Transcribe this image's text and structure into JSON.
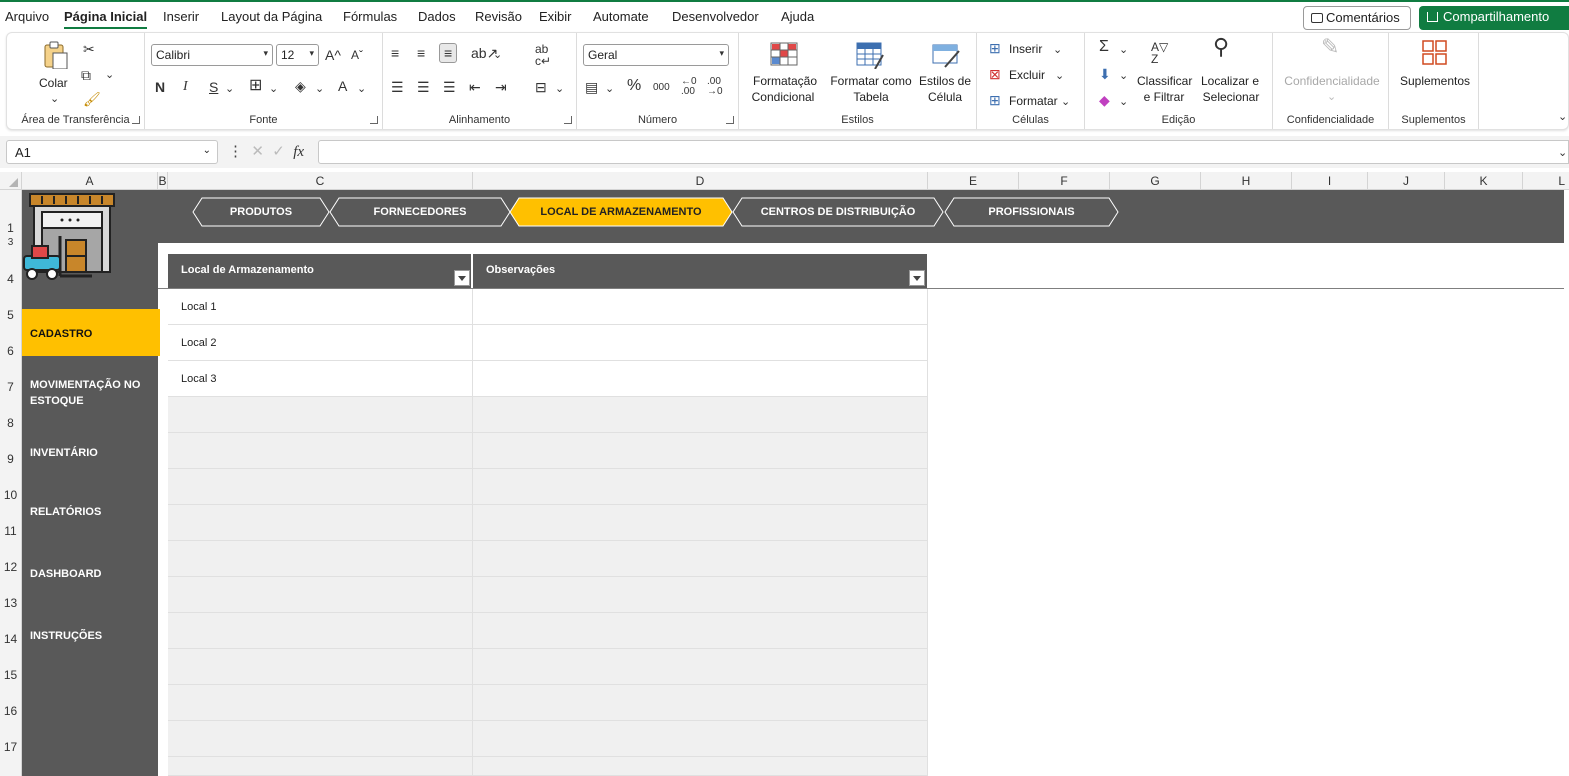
{
  "menu": {
    "items": [
      "Arquivo",
      "Página Inicial",
      "Inserir",
      "Layout da Página",
      "Fórmulas",
      "Dados",
      "Revisão",
      "Exibir",
      "Automate",
      "Desenvolvedor",
      "Ajuda"
    ],
    "active": "Página Inicial",
    "comments_label": "Comentários",
    "share_label": "Compartilhamento"
  },
  "ribbon": {
    "clipboard": {
      "paste_label": "Colar",
      "group_label": "Área de Transferência"
    },
    "font": {
      "font_name": "Calibri",
      "font_size": "12",
      "bold": "N",
      "italic": "I",
      "underline": "S",
      "group_label": "Fonte"
    },
    "alignment": {
      "group_label": "Alinhamento"
    },
    "number": {
      "format": "Geral",
      "percent": "%",
      "thousands": "000",
      "group_label": "Número"
    },
    "styles": {
      "conditional_line1": "Formatação",
      "conditional_line2": "Condicional",
      "table_line1": "Formatar como",
      "table_line2": "Tabela",
      "cell_line1": "Estilos de",
      "cell_line2": "Célula",
      "group_label": "Estilos"
    },
    "cells": {
      "insert": "Inserir",
      "delete": "Excluir",
      "format": "Formatar",
      "group_label": "Células"
    },
    "editing": {
      "sort_line1": "Classificar",
      "sort_line2": "e Filtrar",
      "find_line1": "Localizar e",
      "find_line2": "Selecionar",
      "group_label": "Edição"
    },
    "sensitivity": {
      "label": "Confidencialidade",
      "group_label": "Confidencialidade"
    },
    "addins": {
      "label": "Suplementos",
      "group_label": "Suplementos"
    }
  },
  "formula_bar": {
    "name_box": "A1",
    "fx": "fx",
    "value": ""
  },
  "columns": [
    "A",
    "B",
    "C",
    "D",
    "E",
    "F",
    "G",
    "H",
    "I",
    "J",
    "K",
    "L"
  ],
  "rows": [
    "1",
    "3",
    "4",
    "5",
    "6",
    "7",
    "8",
    "9",
    "10",
    "11",
    "12",
    "13",
    "14",
    "15",
    "16",
    "17"
  ],
  "tabs": [
    "PRODUTOS",
    "FORNECEDORES",
    "LOCAL DE ARMAZENAMENTO",
    "CENTROS DE DISTRIBUIÇÃO",
    "PROFISSIONAIS"
  ],
  "active_tab": "LOCAL DE ARMAZENAMENTO",
  "nav": [
    "CADASTRO",
    "MOVIMENTAÇÃO NO ESTOQUE",
    "INVENTÁRIO",
    "RELATÓRIOS",
    "DASHBOARD",
    "INSTRUÇÕES"
  ],
  "active_nav": "CADASTRO",
  "table": {
    "headers": [
      "Local de Armazenamento",
      "Observações"
    ],
    "rows": [
      [
        "Local 1",
        ""
      ],
      [
        "Local 2",
        ""
      ],
      [
        "Local 3",
        ""
      ]
    ]
  },
  "colors": {
    "excel_green": "#107c41",
    "dark_gray": "#595959",
    "accent_yellow": "#ffc000",
    "empty_row": "#f0f0f0"
  }
}
